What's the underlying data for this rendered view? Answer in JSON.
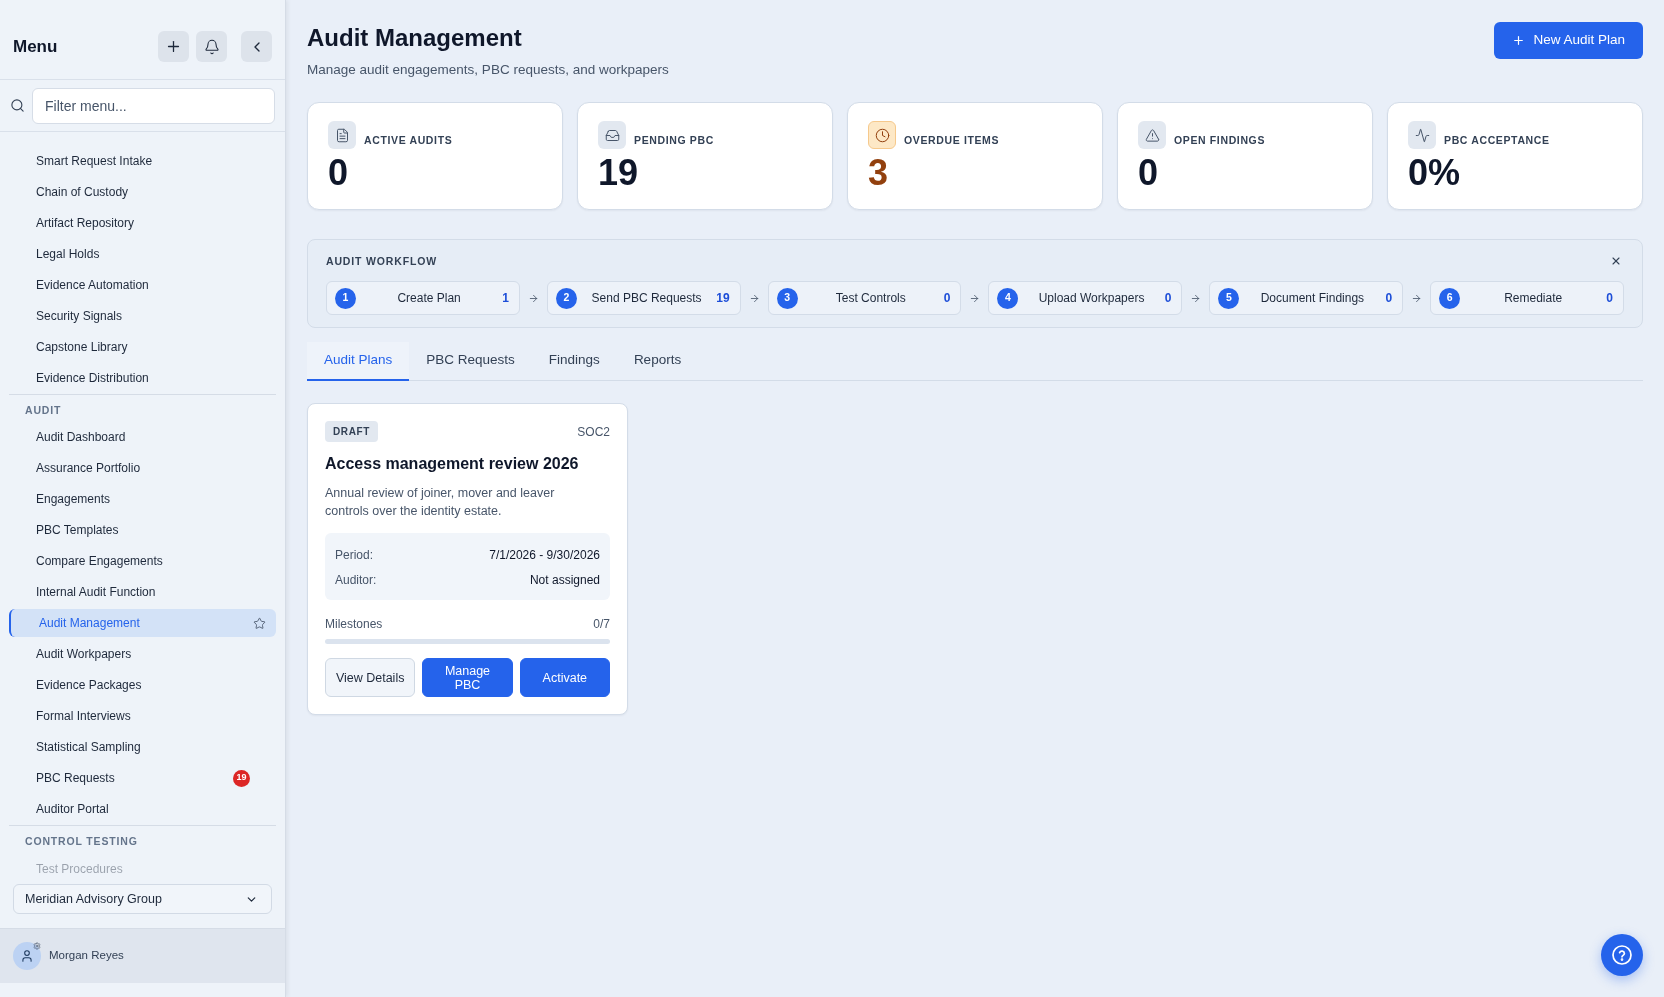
{
  "sidebar": {
    "title": "Menu",
    "search": {
      "placeholder": "Filter menu..."
    },
    "sections": [
      {
        "items": [
          {
            "label": "Smart Request Intake",
            "selected": false,
            "faded": false
          },
          {
            "label": "Chain of Custody",
            "selected": false,
            "faded": false
          },
          {
            "label": "Artifact Repository",
            "selected": false,
            "faded": false
          },
          {
            "label": "Legal Holds",
            "selected": false,
            "faded": false
          },
          {
            "label": "Evidence Automation",
            "selected": false,
            "faded": false
          },
          {
            "label": "Security Signals",
            "selected": false,
            "faded": false
          },
          {
            "label": "Capstone Library",
            "selected": false,
            "faded": false
          },
          {
            "label": "Evidence Distribution",
            "selected": false,
            "faded": false
          }
        ]
      },
      {
        "heading": "AUDIT",
        "items": [
          {
            "label": "Audit Dashboard",
            "selected": false,
            "faded": false
          },
          {
            "label": "Assurance Portfolio",
            "selected": false,
            "faded": false
          },
          {
            "label": "Engagements",
            "selected": false,
            "faded": false
          },
          {
            "label": "PBC Templates",
            "selected": false,
            "faded": false
          },
          {
            "label": "Compare Engagements",
            "selected": false,
            "faded": false
          },
          {
            "label": "Internal Audit Function",
            "selected": false,
            "faded": false
          },
          {
            "label": "Audit Management",
            "selected": true,
            "faded": false
          },
          {
            "label": "Audit Workpapers",
            "selected": false,
            "faded": false
          },
          {
            "label": "Evidence Packages",
            "selected": false,
            "faded": false
          },
          {
            "label": "Formal Interviews",
            "selected": false,
            "faded": false
          },
          {
            "label": "Statistical Sampling",
            "selected": false,
            "faded": false
          },
          {
            "label": "PBC Requests",
            "selected": false,
            "faded": false,
            "badge": "19"
          },
          {
            "label": "Auditor Portal",
            "selected": false,
            "faded": false
          }
        ]
      },
      {
        "heading": "CONTROL TESTING",
        "items": [
          {
            "label": "Test Procedures",
            "selected": false,
            "faded": true
          }
        ]
      }
    ],
    "organization": {
      "value": "Meridian Advisory Group"
    },
    "user": {
      "name": "Morgan Reyes"
    }
  },
  "main": {
    "title": "Audit Management",
    "subtitle": "Manage audit engagements, PBC requests, and workpapers",
    "primary_button": "New Audit Plan",
    "stats": [
      {
        "label": "ACTIVE AUDITS",
        "value": "0",
        "highlighted": false
      },
      {
        "label": "PENDING PBC",
        "value": "19",
        "highlighted": false
      },
      {
        "label": "OVERDUE ITEMS",
        "value": "3",
        "highlighted": true
      },
      {
        "label": "OPEN FINDINGS",
        "value": "0",
        "highlighted": false
      },
      {
        "label": "PBC ACCEPTANCE",
        "value": "0%",
        "highlighted": false
      }
    ],
    "workflow": {
      "title": "AUDIT WORKFLOW",
      "steps": [
        {
          "number": "1",
          "label": "Create Plan",
          "count": "1"
        },
        {
          "number": "2",
          "label": "Send PBC Requests",
          "count": "19"
        },
        {
          "number": "3",
          "label": "Test Controls",
          "count": "0"
        },
        {
          "number": "4",
          "label": "Upload Workpapers",
          "count": "0"
        },
        {
          "number": "5",
          "label": "Document Findings",
          "count": "0"
        },
        {
          "number": "6",
          "label": "Remediate",
          "count": "0"
        }
      ]
    },
    "tabs": [
      {
        "label": "Audit Plans",
        "selected": true
      },
      {
        "label": "PBC Requests",
        "selected": false
      },
      {
        "label": "Findings",
        "selected": false
      },
      {
        "label": "Reports",
        "selected": false
      }
    ],
    "plans": [
      {
        "status": "DRAFT",
        "framework": "SOC2",
        "title": "Access management review 2026",
        "description": "Annual review of joiner, mover and leaver controls over the identity estate.",
        "details": [
          {
            "label": "Period:",
            "value": "7/1/2026 - 9/30/2026"
          },
          {
            "label": "Auditor:",
            "value": "Not assigned"
          }
        ],
        "milestones": {
          "label": "Milestones",
          "reading": "0/7",
          "level": 0
        },
        "buttons": [
          {
            "label": "View Details",
            "kind": "secondary"
          },
          {
            "label": "Manage PBC",
            "kind": "primary"
          },
          {
            "label": "Activate",
            "kind": "primary"
          }
        ]
      }
    ]
  }
}
